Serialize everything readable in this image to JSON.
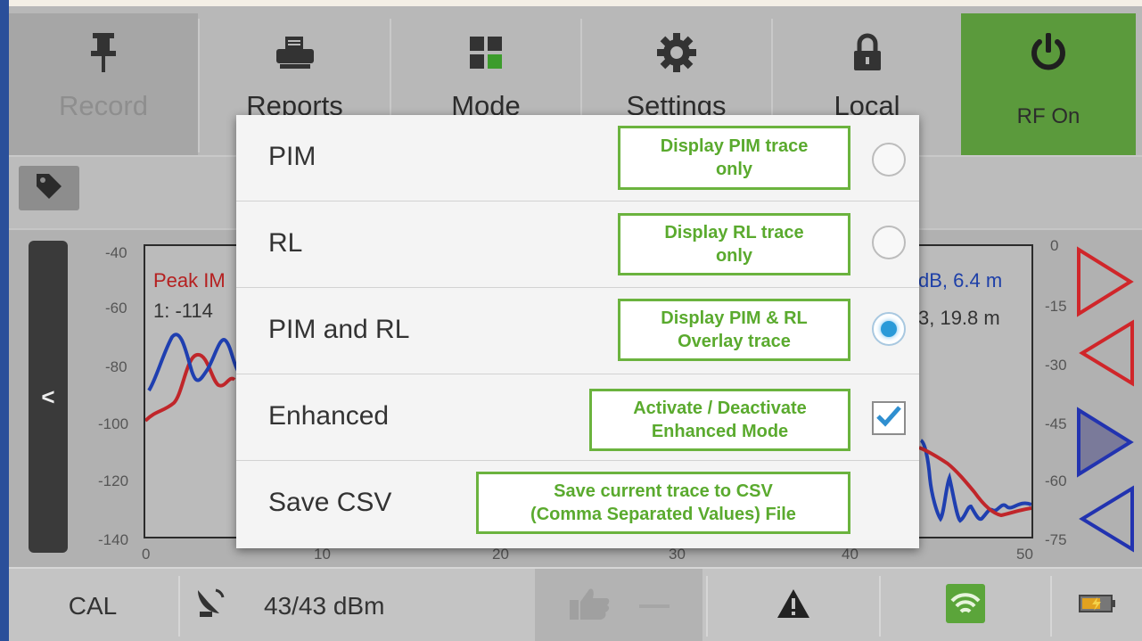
{
  "toolbar": {
    "record": "Record",
    "reports": "Reports",
    "mode": "Mode",
    "settings": "Settings",
    "local": "Local",
    "rf_on": "RF On"
  },
  "chart": {
    "left_ticks": [
      "-40",
      "-60",
      "-80",
      "-100",
      "-120",
      "-140"
    ],
    "right_ticks": [
      "0",
      "-15",
      "-30",
      "-45",
      "-60",
      "-75"
    ],
    "x_ticks": [
      "0",
      "10",
      "20",
      "30",
      "40",
      "50"
    ],
    "peak_label": "Peak IM",
    "marker_label": "1: -114",
    "right_label1": "dB, 6.4 m",
    "right_label2": "3, 19.8 m",
    "handle_glyph": "<"
  },
  "menu": {
    "items": [
      {
        "label": "PIM",
        "note_line1": "Display PIM trace",
        "note_line2": "only",
        "control": "radio",
        "checked": false
      },
      {
        "label": "RL",
        "note_line1": "Display RL trace",
        "note_line2": "only",
        "control": "radio",
        "checked": false
      },
      {
        "label": "PIM and RL",
        "note_line1": "Display PIM & RL",
        "note_line2": "Overlay trace",
        "control": "radio",
        "checked": true
      },
      {
        "label": "Enhanced",
        "note_line1": "Activate / Deactivate",
        "note_line2": "Enhanced Mode",
        "control": "checkbox",
        "checked": true
      },
      {
        "label": "Save CSV",
        "note_line1": "Save current trace to CSV",
        "note_line2": "(Comma Separated Values) File",
        "control": "none",
        "checked": false
      }
    ]
  },
  "statusbar": {
    "cal": "CAL",
    "power": "43/43 dBm"
  },
  "colors": {
    "rf_on_bg": "#5b9a3c",
    "annotation": "#6bb33e",
    "pim_trace": "#c0262a",
    "rl_trace": "#1f3fb0",
    "radio_selected": "#2a9ad8"
  },
  "icons": [
    "pin-icon",
    "printer-icon",
    "grid-icon",
    "gear-icon",
    "lock-icon",
    "power-icon",
    "tag-icon",
    "satellite-dish-icon",
    "thumbs-up-icon",
    "warning-icon",
    "wifi-icon",
    "battery-icon",
    "triangle-right-icon",
    "triangle-left-icon"
  ]
}
